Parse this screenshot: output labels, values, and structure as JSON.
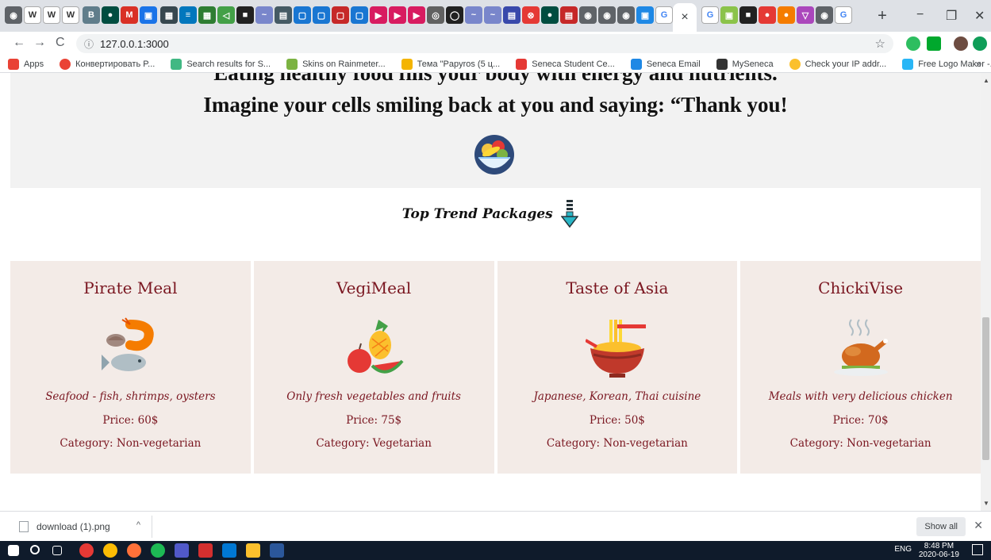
{
  "browser": {
    "new_tab_symbol": "+",
    "active_tab_close": "×",
    "minimize": "−",
    "maximize": "❐",
    "close": "✕",
    "back": "←",
    "forward": "→",
    "reload": "C",
    "info": "ⓘ",
    "url": "127.0.0.1:3000",
    "bookmark_star": "☆",
    "bookmarks": [
      {
        "label": "Apps",
        "color": "#e94235"
      },
      {
        "label": "Конвертировать P...",
        "color": "#ea4335"
      },
      {
        "label": "Search results for S...",
        "color": "#41b883"
      },
      {
        "label": "Skins on Rainmeter...",
        "color": "#7cb342"
      },
      {
        "label": "Тема \"Papyros (5 ц...",
        "color": "#f4b400"
      },
      {
        "label": "Seneca Student Ce...",
        "color": "#e53935"
      },
      {
        "label": "Seneca Email",
        "color": "#1e88e5"
      },
      {
        "label": "MySeneca",
        "color": "#333333"
      },
      {
        "label": "Check your IP addr...",
        "color": "#fbc02d"
      },
      {
        "label": "Free Logo Maker -...",
        "color": "#29b6f6"
      }
    ],
    "bookmarks_more": "»"
  },
  "hero": {
    "line1": "Eating healthy food fills your body with energy and nutrients.",
    "line2": "Imagine your cells smiling back at you and saying: “Thank you!"
  },
  "section": {
    "title": "Top Trend Packages"
  },
  "packages": [
    {
      "title": "Pirate Meal",
      "desc": "Seafood - fish, shrimps, oysters",
      "price": "Price: 60$",
      "category": "Category: Non-vegetarian",
      "icon": "seafood-icon"
    },
    {
      "title": "VegiMeal",
      "desc": "Only fresh vegetables and fruits",
      "price": "Price: 75$",
      "category": "Category: Vegetarian",
      "icon": "fruits-icon"
    },
    {
      "title": "Taste of Asia",
      "desc": "Japanese, Korean, Thai cuisine",
      "price": "Price: 50$",
      "category": "Category: Non-vegetarian",
      "icon": "noodles-icon"
    },
    {
      "title": "ChickiVise",
      "desc": "Meals with very delicious chicken",
      "price": "Price: 70$",
      "category": "Category: Non-vegetarian",
      "icon": "roast-chicken-icon"
    }
  ],
  "download_shelf": {
    "file_name": "download (1).png",
    "caret": "^",
    "show_all": "Show all",
    "close": "✕"
  },
  "taskbar": {
    "tray_text": "ENG",
    "time": "8:48 PM",
    "date": "2020-06-19"
  }
}
